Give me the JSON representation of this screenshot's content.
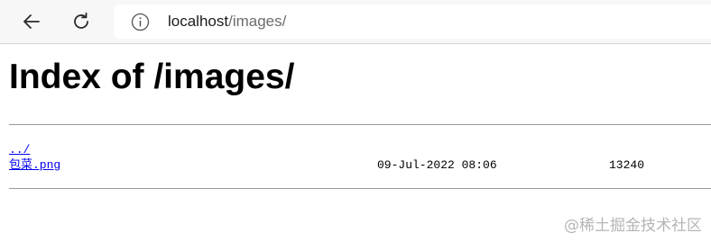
{
  "browser": {
    "icons": {
      "back": "arrow-left-icon",
      "reload": "reload-icon",
      "site_info": "info-circle-icon"
    },
    "address": {
      "host": "localhost",
      "path": "/images/"
    }
  },
  "page": {
    "title": "Index of /images/",
    "entries": [
      {
        "name": "../",
        "date": "",
        "size": ""
      },
      {
        "name": "包菜.png",
        "date": "09-Jul-2022 08:06",
        "size": "13240"
      }
    ]
  },
  "watermark": "@稀土掘金技术社区",
  "colors": {
    "link": "#0000ee",
    "toolbar_bg": "#f7f7f7"
  }
}
